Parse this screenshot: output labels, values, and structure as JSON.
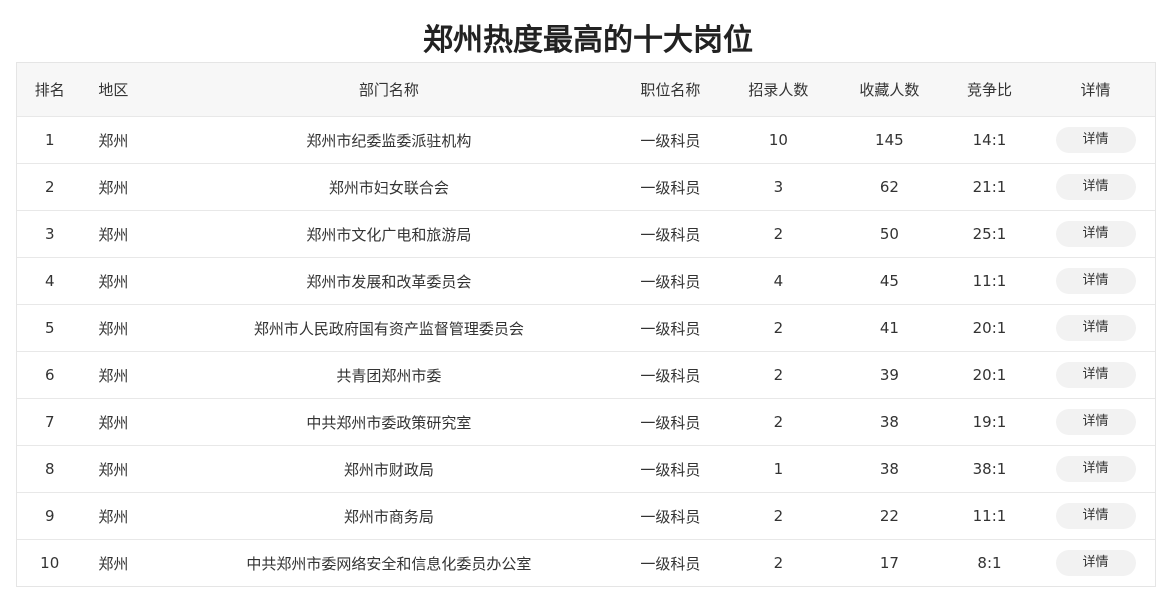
{
  "title": "郑州热度最高的十大岗位",
  "headers": {
    "rank": "排名",
    "area": "地区",
    "dept": "部门名称",
    "job": "职位名称",
    "recruit": "招录人数",
    "fav": "收藏人数",
    "ratio": "竞争比",
    "detail": "详情"
  },
  "rows": [
    {
      "rank": "1",
      "area": "郑州",
      "dept": "郑州市纪委监委派驻机构",
      "job": "一级科员",
      "recruit": "10",
      "fav": "145",
      "ratio": "14:1",
      "detail": "详情"
    },
    {
      "rank": "2",
      "area": "郑州",
      "dept": "郑州市妇女联合会",
      "job": "一级科员",
      "recruit": "3",
      "fav": "62",
      "ratio": "21:1",
      "detail": "详情"
    },
    {
      "rank": "3",
      "area": "郑州",
      "dept": "郑州市文化广电和旅游局",
      "job": "一级科员",
      "recruit": "2",
      "fav": "50",
      "ratio": "25:1",
      "detail": "详情"
    },
    {
      "rank": "4",
      "area": "郑州",
      "dept": "郑州市发展和改革委员会",
      "job": "一级科员",
      "recruit": "4",
      "fav": "45",
      "ratio": "11:1",
      "detail": "详情"
    },
    {
      "rank": "5",
      "area": "郑州",
      "dept": "郑州市人民政府国有资产监督管理委员会",
      "job": "一级科员",
      "recruit": "2",
      "fav": "41",
      "ratio": "20:1",
      "detail": "详情"
    },
    {
      "rank": "6",
      "area": "郑州",
      "dept": "共青团郑州市委",
      "job": "一级科员",
      "recruit": "2",
      "fav": "39",
      "ratio": "20:1",
      "detail": "详情"
    },
    {
      "rank": "7",
      "area": "郑州",
      "dept": "中共郑州市委政策研究室",
      "job": "一级科员",
      "recruit": "2",
      "fav": "38",
      "ratio": "19:1",
      "detail": "详情"
    },
    {
      "rank": "8",
      "area": "郑州",
      "dept": "郑州市财政局",
      "job": "一级科员",
      "recruit": "1",
      "fav": "38",
      "ratio": "38:1",
      "detail": "详情"
    },
    {
      "rank": "9",
      "area": "郑州",
      "dept": "郑州市商务局",
      "job": "一级科员",
      "recruit": "2",
      "fav": "22",
      "ratio": "11:1",
      "detail": "详情"
    },
    {
      "rank": "10",
      "area": "郑州",
      "dept": "中共郑州市委网络安全和信息化委员办公室",
      "job": "一级科员",
      "recruit": "2",
      "fav": "17",
      "ratio": "8:1",
      "detail": "详情"
    }
  ]
}
